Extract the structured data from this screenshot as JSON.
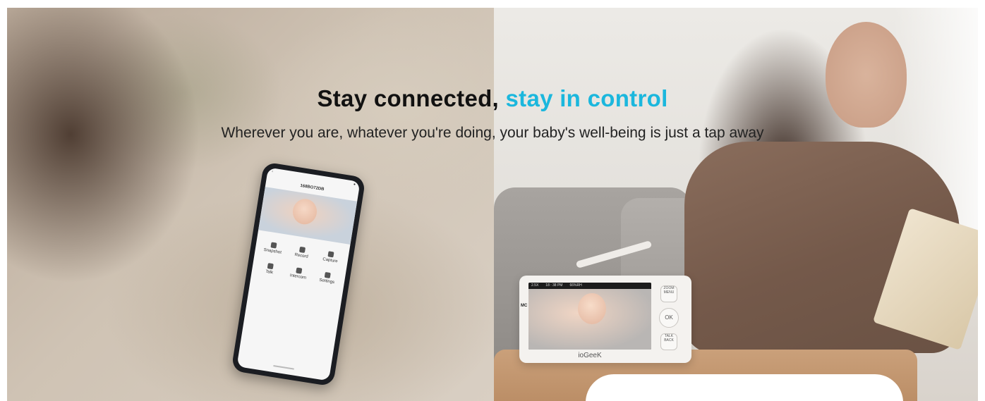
{
  "banner": {
    "headline_part1": "Stay connected,",
    "headline_part2": "stay in control",
    "subtitle": "Wherever you are, whatever you're doing, your baby's well-being is just a tap away",
    "accent_color": "#1bb7dd"
  },
  "phone": {
    "device_title": "168BO72DB",
    "grid_items": [
      "Snapshot",
      "Record",
      "Capture",
      "Talk",
      "Intercom",
      "Settings"
    ]
  },
  "monitor": {
    "brand": "ioGeeK",
    "status": [
      "2.5X",
      "18 : 38 PM",
      "66%RH"
    ],
    "buttons": {
      "zoom": "ZOOM MENU",
      "ok": "OK",
      "talk": "TALK BACK"
    }
  }
}
